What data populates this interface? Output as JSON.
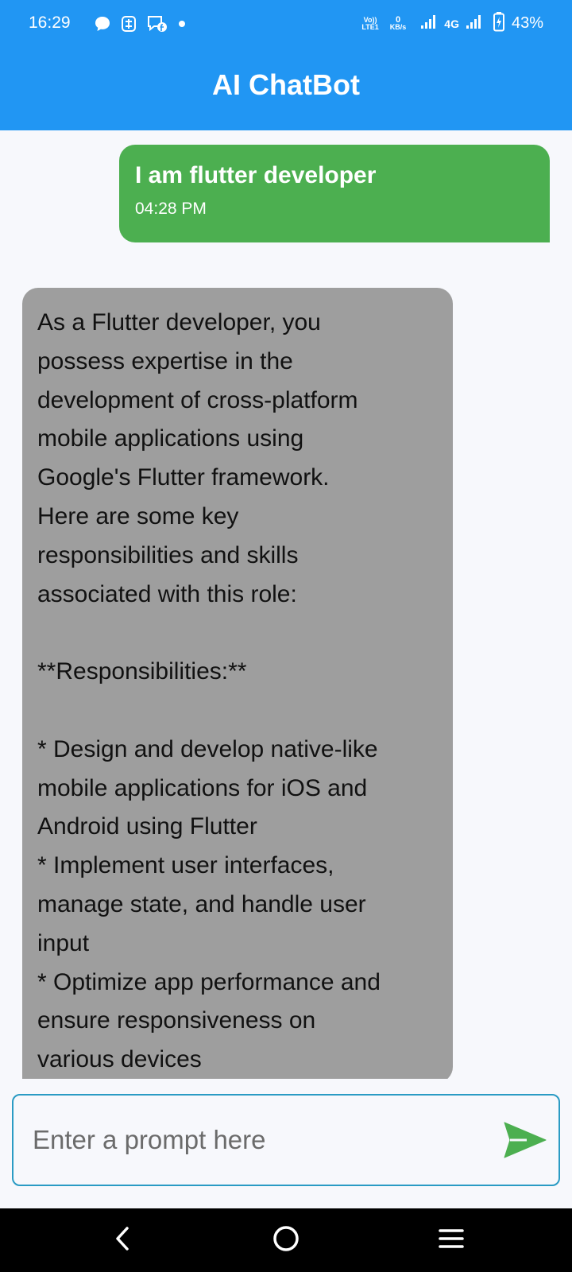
{
  "status_bar": {
    "time": "16:29",
    "notification_icons": [
      "chat-bubble-icon",
      "sync-icon",
      "facebook-messenger-icon",
      "dot-icon"
    ],
    "volte_top": "Vo))",
    "volte_bottom": "LTE1",
    "data_rate_value": "0",
    "data_rate_unit": "KB/s",
    "network_type": "4G",
    "battery_percent": "43%"
  },
  "app_bar": {
    "title": "AI ChatBot"
  },
  "chat": {
    "messages": [
      {
        "role": "user",
        "text": "I am flutter developer",
        "time": "04:28 PM"
      },
      {
        "role": "bot",
        "text": "As a Flutter developer, you\npossess expertise in the\ndevelopment of cross-platform\nmobile applications using\nGoogle's Flutter framework.\nHere are some key\nresponsibilities and skills\nassociated with this role:\n\n**Responsibilities:**\n\n* Design and develop native-like\nmobile applications for iOS and\nAndroid using Flutter\n* Implement user interfaces,\nmanage state, and handle user\ninput\n* Optimize app performance and\nensure responsiveness on\nvarious devices"
      }
    ]
  },
  "input": {
    "placeholder": "Enter a prompt here",
    "value": ""
  },
  "colors": {
    "primary": "#2196f3",
    "user_bubble": "#4caf50",
    "bot_bubble": "#9e9e9e",
    "send_icon": "#4caf50",
    "input_border": "#2a9bc4"
  },
  "nav_bar": {
    "buttons": [
      "back-icon",
      "home-icon",
      "menu-icon"
    ]
  }
}
